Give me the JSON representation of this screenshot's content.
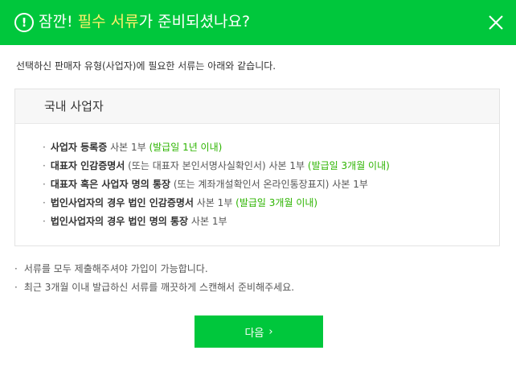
{
  "header": {
    "alert_icon_glyph": "!",
    "title_prefix": "잠깐! ",
    "title_highlight": "필수 서류",
    "title_suffix": "가 준비되셨나요?",
    "close_icon": "close-icon",
    "colors": {
      "background": "#00c73c",
      "highlight": "#fff06a"
    }
  },
  "intro": "선택하신 판매자 유형(사업자)에 필요한 서류는 아래와 같습니다.",
  "box": {
    "title": "국내 사업자",
    "bullet": "·",
    "items": [
      {
        "bold": "사업자 등록증",
        "plain": " 사본 1부 ",
        "green": "(발급일 1년 이내)"
      },
      {
        "bold": "대표자 인감증명서",
        "plain": " (또는 대표자 본인서명사실확인서) 사본 1부 ",
        "green": "(발급일 3개월 이내)"
      },
      {
        "bold": "대표자 혹은 사업자 명의 통장",
        "plain": " (또는 계좌개설확인서 온라인통장표지) 사본 1부",
        "green": ""
      },
      {
        "bold": "법인사업자의 경우 법인 인감증명서",
        "plain": " 사본 1부 ",
        "green": "(발급일 3개월 이내)"
      },
      {
        "bold": "법인사업자의 경우 법인 명의 통장",
        "plain": " 사본 1부",
        "green": ""
      }
    ]
  },
  "notes": {
    "bullet": "·",
    "items": [
      "서류를 모두 제출해주셔야 가입이 가능합니다.",
      "최근 3개월 이내 발급하신 서류를 깨끗하게 스캔해서 준비해주세요."
    ]
  },
  "next_button": {
    "label": "다음",
    "arrow": "›",
    "color": "#00c73c"
  }
}
